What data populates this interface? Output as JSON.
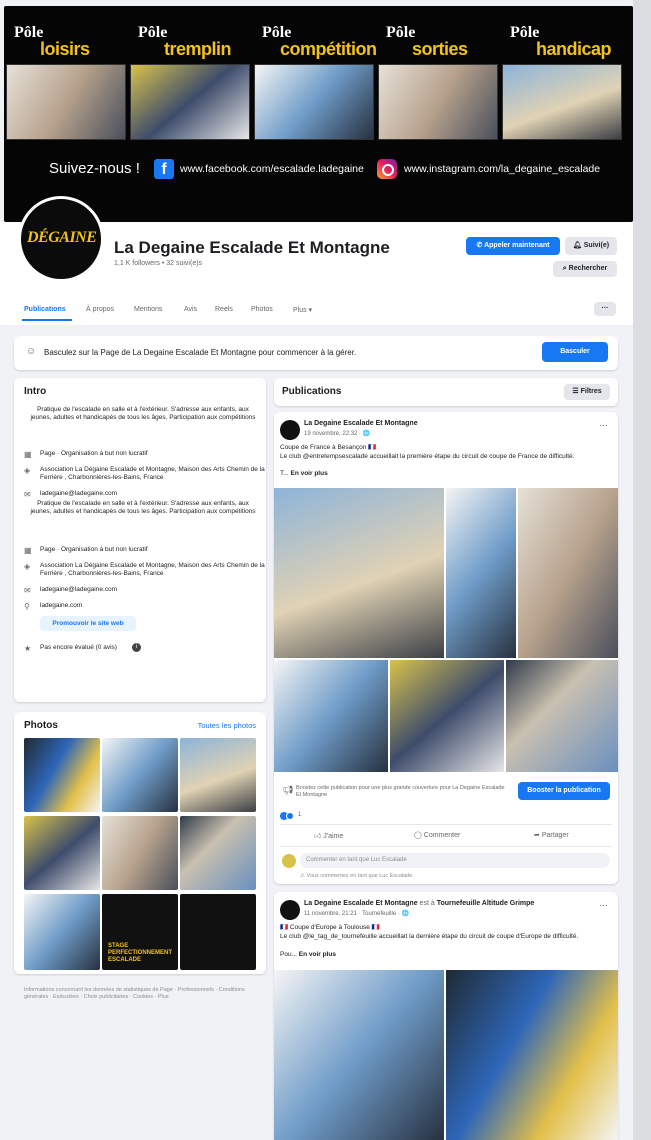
{
  "cover": {
    "poles": [
      {
        "word1": "Pôle",
        "word2": "loisirs"
      },
      {
        "word1": "Pôle",
        "word2": "tremplin"
      },
      {
        "word1": "Pôle",
        "word2": "compétition"
      },
      {
        "word1": "Pôle",
        "word2": "sorties"
      },
      {
        "word1": "Pôle",
        "word2": "handicap"
      }
    ],
    "follow_label": "Suivez-nous !",
    "facebook_url": "www.facebook.com/escalade.ladegaine",
    "instagram_url": "www.instagram.com/la_degaine_escalade",
    "accent_color": "#f2c21b"
  },
  "profile": {
    "logo_text": "DÉGAINE",
    "name": "La Degaine Escalade Et Montagne",
    "stats": "1,1 K followers • 32 suivi(e)s",
    "call_button": "Appeler maintenant",
    "follow_button": "Suivi(e)",
    "search_button": "Rechercher"
  },
  "tabs": [
    "Publications",
    "À propos",
    "Mentions",
    "Avis",
    "Reels",
    "Photos",
    "Plus ▾"
  ],
  "more_button": "···",
  "banner": {
    "text": "Basculez sur la Page de La Degaine Escalade Et Montagne pour commencer à la gérer.",
    "button": "Basculer"
  },
  "intro": {
    "title": "Intro",
    "desc1": "Pratique de l'escalade en salle et à l'extérieur. S'adresse aux enfants, aux jeunes, adultes et handicapés de tous les âges. Participation aux compétitions",
    "page1": "Page · Organisation à but non lucratif",
    "address1": "Association La Dégaine Escalade et Montagne, Maison des Arts Chemin de la Ferrière , Charbonnières-les-Bains, France",
    "email1": "ladegaine@ladegaine.com",
    "desc2": "Pratique de l'escalade en salle et à l'extérieur. S'adresse aux enfants, aux jeunes, adultes et handicapés de tous les âges. Participation aux compétitions",
    "page2": "Page · Organisation à but non lucratif",
    "address2": "Association La Dégaine Escalade et Montagne, Maison des Arts Chemin de la Ferrière , Charbonnières-les-Bains, France",
    "email2": "ladegaine@ladegaine.com",
    "website": "ladegaine.com",
    "promote": "Promouvoir le site web",
    "rating": "Pas encore évalué (0 avis)"
  },
  "photos": {
    "title": "Photos",
    "all": "Toutes les photos",
    "stage_text": "STAGE PERFECTIONNEMENT ESCALADE"
  },
  "footer": "Informations concernant les données de statistiques de Page · Professionnels · Conditions générales · Exécutées · Choix publicitaires · Cookies · Plus",
  "publications": {
    "title": "Publications",
    "filters": "Filtres",
    "post1": {
      "author": "La Degaine Escalade Et Montagne",
      "date": "19 novembre, 22:32 · 🌐",
      "line1": "Coupe de France à Besançon 🇫🇷",
      "line2": "Le club @entretempsescalade accueillait la première étape du circuit de coupe de France de difficulté.",
      "more_prefix": "T...",
      "more": "En voir plus",
      "boost_text": "Boostez cette publication pour une plus grande couverture pour La Degaine Escalade Et Montagne",
      "boost_button": "Booster la publication",
      "reactions": "1",
      "like": "J'aime",
      "comment": "Commenter",
      "share": "Partager",
      "comment_placeholder": "Commenter en tant que Luc Escalade",
      "warning": "Vous commentez en tant que Luc Escalade."
    },
    "post2": {
      "author": "La Degaine Escalade Et Montagne",
      "with": "est à",
      "place": "Tournefeuille Altitude Grimpe",
      "date": "11 novembre, 21:21 · Tournefeuille · 🌐",
      "line1": "🇫🇷 Coupe d'Europe à Toulouse 🇫🇷",
      "line2": "Le club @le_tag_de_tournefeuille accueillait la dernière étape du circuit de coupe d'Europe de difficulté.",
      "more_prefix": "Pou...",
      "more": "En voir plus"
    }
  }
}
